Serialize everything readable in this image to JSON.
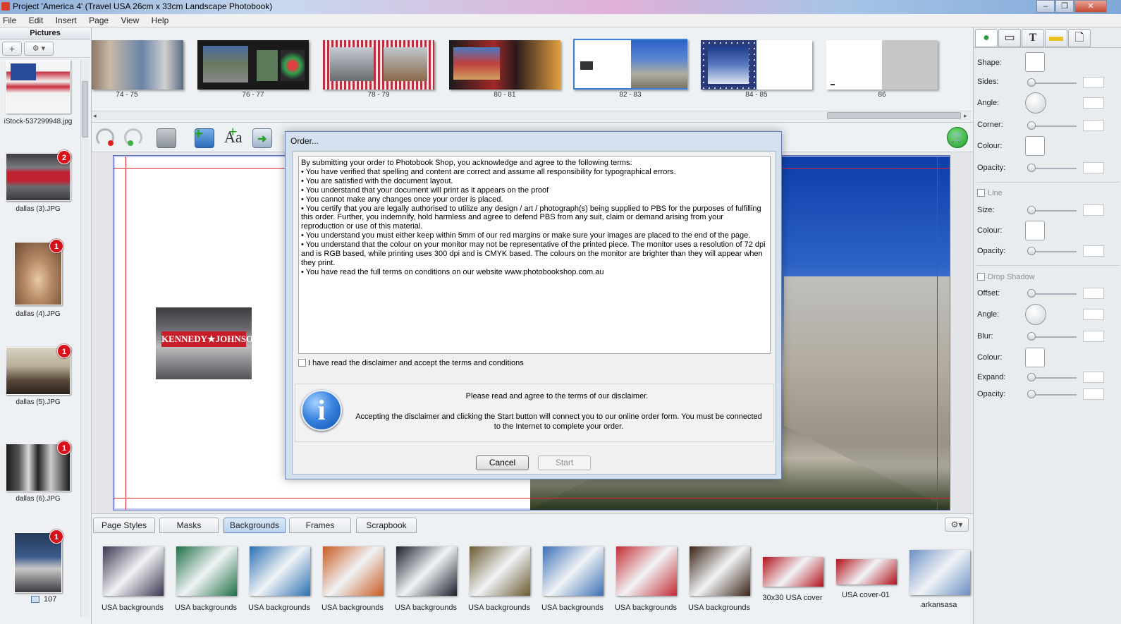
{
  "window": {
    "title": "Project 'America 4' (Travel USA 26cm x 33cm Landscape Photobook)"
  },
  "menu": [
    "File",
    "Edit",
    "Insert",
    "Page",
    "View",
    "Help"
  ],
  "left_panel": {
    "title": "Pictures",
    "add_button": "+",
    "settings_button": "⚙ ▾",
    "images": [
      {
        "name": "iStock-537299948.jpg",
        "badge": ""
      },
      {
        "name": "dallas (3).JPG",
        "badge": "2"
      },
      {
        "name": "dallas (4).JPG",
        "badge": "1"
      },
      {
        "name": "dallas (5).JPG",
        "badge": "1"
      },
      {
        "name": "dallas (6).JPG",
        "badge": "1"
      },
      {
        "name": "",
        "badge": "1"
      }
    ],
    "count": "107"
  },
  "spreads": [
    "74 - 75",
    "76 - 77",
    "78 - 79",
    "80 - 81",
    "82 - 83",
    "84 - 85",
    "86"
  ],
  "canvas": {
    "small_photo_text": "KENNEDY★JOHNSON"
  },
  "tabs": [
    "Page Styles",
    "Masks",
    "Backgrounds",
    "Frames",
    "Scrapbook"
  ],
  "active_tab": "Backgrounds",
  "gallery": [
    {
      "label": "USA backgrounds",
      "color": "#3b3550"
    },
    {
      "label": "USA backgrounds",
      "color": "#1f6f45"
    },
    {
      "label": "USA backgrounds",
      "color": "#2a6fb2"
    },
    {
      "label": "USA backgrounds",
      "color": "#c95a20"
    },
    {
      "label": "USA backgrounds",
      "color": "#1a1e2a"
    },
    {
      "label": "USA backgrounds",
      "color": "#6a5a30"
    },
    {
      "label": "USA backgrounds",
      "color": "#3b6fb5"
    },
    {
      "label": "USA backgrounds",
      "color": "#c42a34"
    },
    {
      "label": "USA backgrounds",
      "color": "#3a2216"
    },
    {
      "label": "30x30 USA cover",
      "color": "#b3101a"
    },
    {
      "label": "USA cover-01",
      "color": "#b3101a"
    },
    {
      "label": "arkansasa",
      "color": "#6c8fc4"
    }
  ],
  "right_panel": {
    "shape": {
      "shape_label": "Shape:",
      "sides_label": "Sides:",
      "angle_label": "Angle:",
      "corner_label": "Corner:",
      "colour_label": "Colour:",
      "opacity_label": "Opacity:"
    },
    "line": {
      "title": "Line",
      "size_label": "Size:",
      "colour_label": "Colour:",
      "opacity_label": "Opacity:"
    },
    "drop_shadow": {
      "title": "Drop Shadow",
      "offset_label": "Offset:",
      "angle_label": "Angle:",
      "blur_label": "Blur:",
      "colour_label": "Colour:",
      "expand_label": "Expand:",
      "opacity_label": "Opacity:"
    }
  },
  "dialog": {
    "title": "Order...",
    "terms": [
      "By submitting your order to Photobook Shop, you acknowledge and agree to the following terms:",
      "• You have verified that spelling and content are correct and assume all responsibility for typographical errors.",
      "• You are satisfied with the document layout.",
      "• You understand that your document will print as it appears on the proof",
      "• You cannot make any changes once your order is placed.",
      "• You certify that you are legally authorised to utilize any design / art / photograph(s) being supplied to PBS for the purposes of fulfilling this order. Further, you indemnify, hold harmless and agree to defend PBS from any suit, claim or demand arising from your reproduction or use of this material.",
      "• You understand you must either keep within 5mm of our red margins or make sure your images are placed to the end of the page.",
      "• You understand that the colour on your monitor may not be representative of the printed piece. The monitor uses a resolution of 72 dpi and is RGB based, while printing uses 300 dpi and is CMYK based. The colours on the monitor are brighter than they will appear when they print.",
      "• You have read the full terms on conditions on our website www.photobookshop.com.au"
    ],
    "checkbox_label": "I have read the disclaimer and accept the terms and conditions",
    "info_line1": "Please read and agree to the terms of our disclaimer.",
    "info_line2": "Accepting the disclaimer and clicking the Start button will connect you to our online order form. You must be connected to the Internet to complete your order.",
    "cancel_label": "Cancel",
    "start_label": "Start"
  }
}
